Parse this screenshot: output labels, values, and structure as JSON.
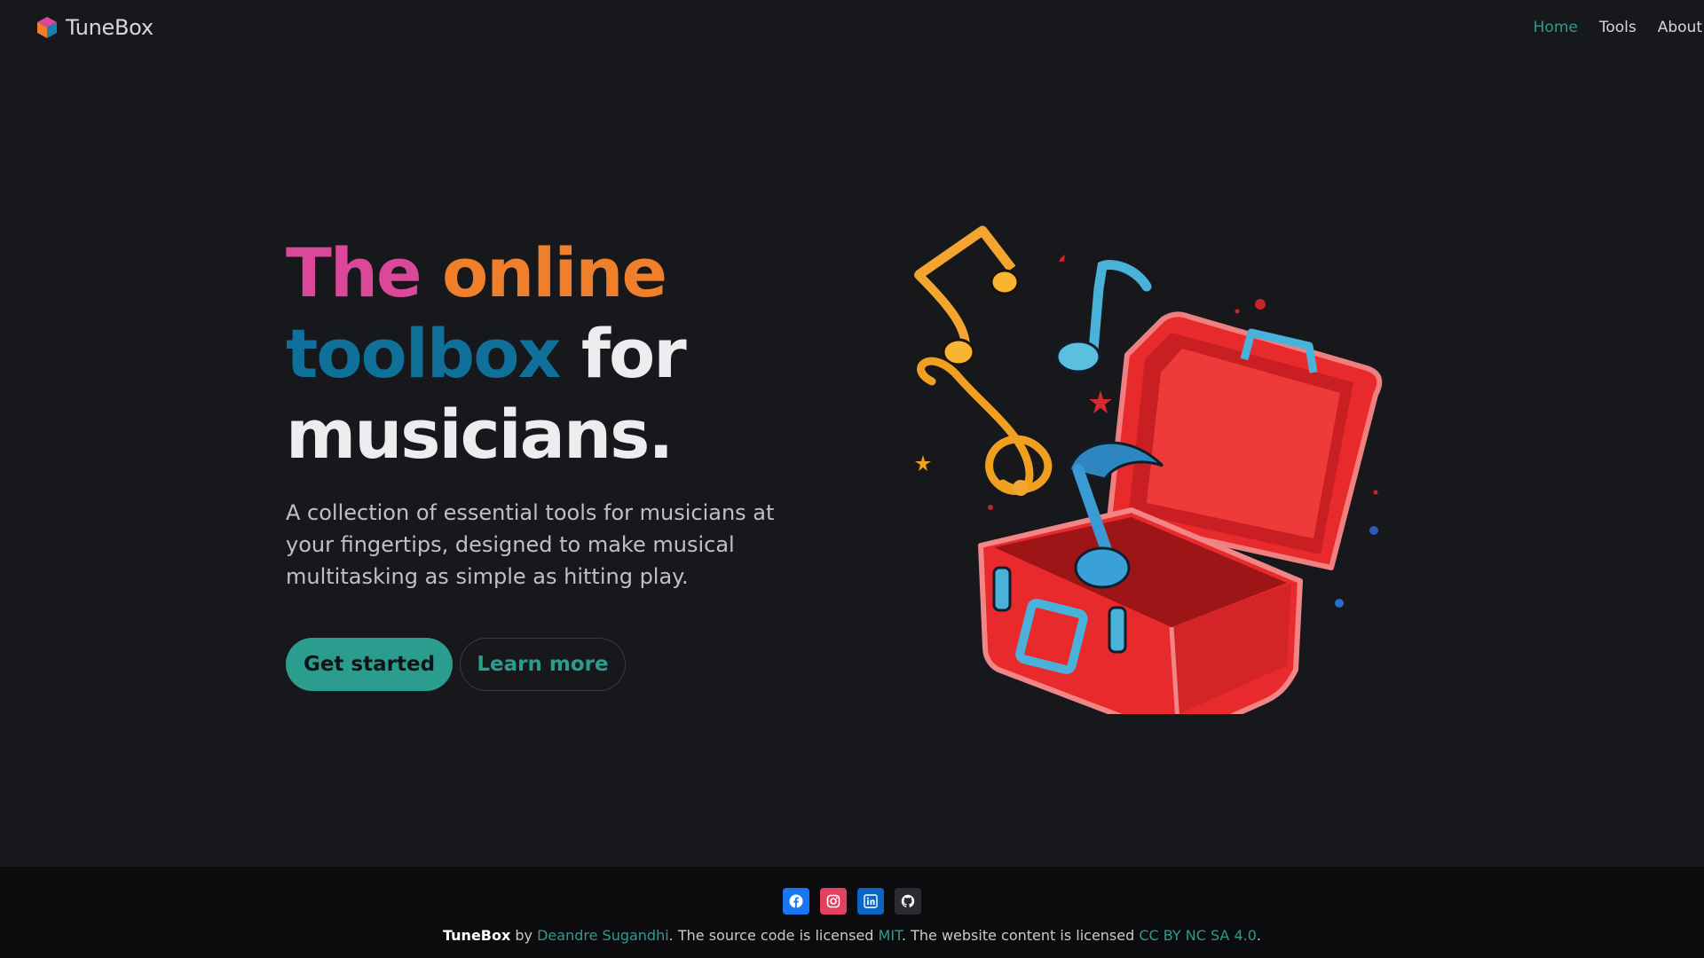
{
  "brand": {
    "name": "TuneBox"
  },
  "nav": {
    "items": [
      {
        "label": "Home",
        "active": true
      },
      {
        "label": "Tools",
        "active": false
      },
      {
        "label": "About",
        "active": false
      }
    ]
  },
  "hero": {
    "title_parts": {
      "the": "The",
      "online": "online",
      "toolbox": "toolbox",
      "for": "for",
      "musicians": "musicians."
    },
    "subtitle": "A collection of essential tools for musicians at your fingertips, designed to make musical multitasking as simple as hitting play.",
    "primary_button": "Get started",
    "secondary_button": "Learn more",
    "colors": {
      "magenta": "#db4899",
      "orange": "#f07f2b",
      "teal_blue": "#0f7199",
      "accent": "#2a9d8f"
    }
  },
  "footer": {
    "socials": [
      "facebook-icon",
      "instagram-icon",
      "linkedin-icon",
      "github-icon"
    ],
    "brand": "TuneBox",
    "by": "by",
    "author": "Deandre Sugandhi",
    "source_text": ". The source code is licensed",
    "source_license": "MIT",
    "content_text": ". The website content is licensed",
    "content_license": "CC BY NC SA 4.0",
    "end": "."
  }
}
